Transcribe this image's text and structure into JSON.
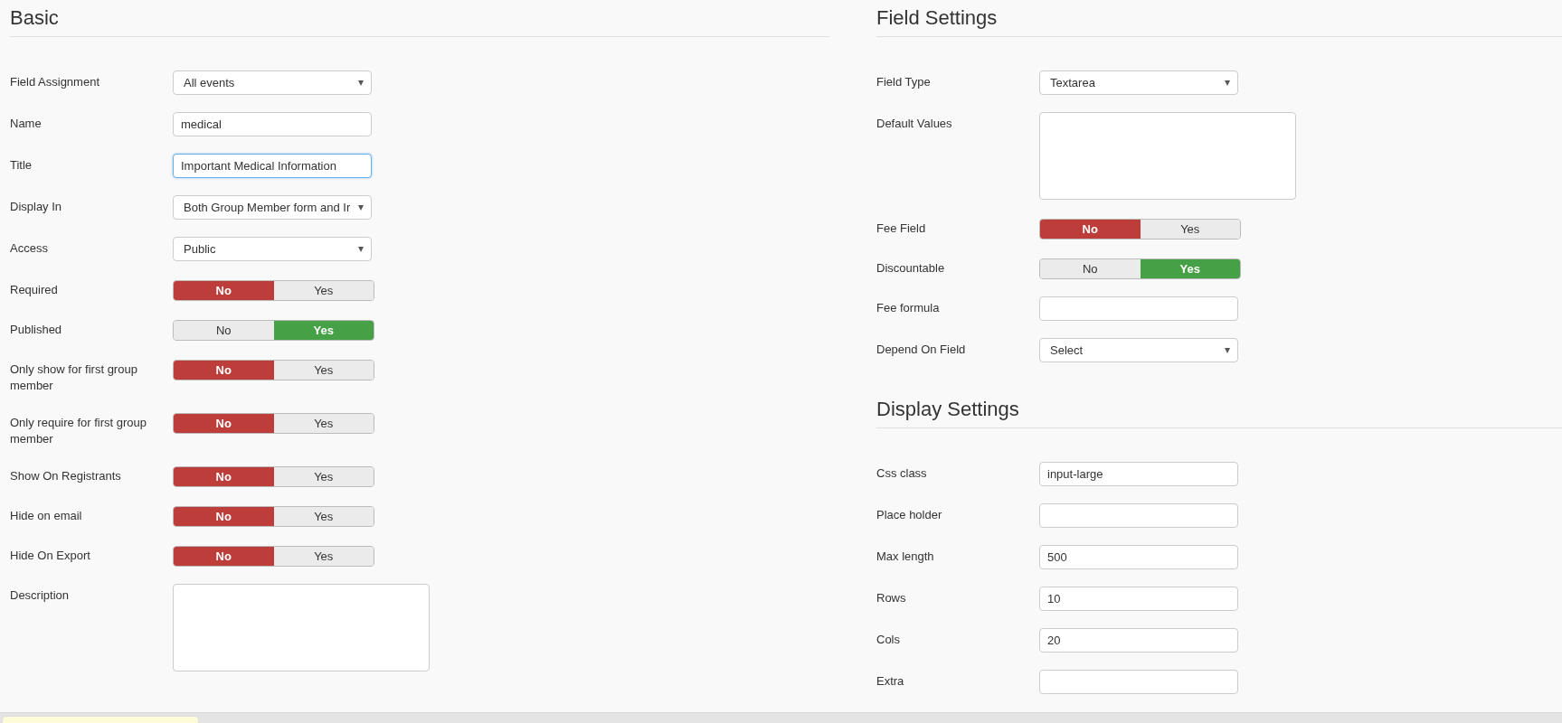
{
  "sections": [
    {
      "title": "Basic",
      "fields": [
        {
          "label": "Field Assignment",
          "kind": "select",
          "value": "All events"
        },
        {
          "label": "Name",
          "kind": "text",
          "value": "medical",
          "focused": false
        },
        {
          "label": "Title",
          "kind": "text",
          "value": "Important Medical Information",
          "focused": true
        },
        {
          "label": "Display In",
          "kind": "select",
          "value": "Both Group Member form and Ir"
        },
        {
          "label": "Access",
          "kind": "select",
          "value": "Public"
        },
        {
          "label": "Required",
          "kind": "toggle",
          "options": [
            {
              "label": "No",
              "selected": true
            },
            {
              "label": "Yes",
              "selected": false
            }
          ]
        },
        {
          "label": "Published",
          "kind": "toggle",
          "options": [
            {
              "label": "No",
              "selected": false
            },
            {
              "label": "Yes",
              "selected": true
            }
          ]
        },
        {
          "label": "Only show for first group member",
          "kind": "toggle",
          "options": [
            {
              "label": "No",
              "selected": true
            },
            {
              "label": "Yes",
              "selected": false
            }
          ]
        },
        {
          "label": "Only require for first group member",
          "kind": "toggle",
          "options": [
            {
              "label": "No",
              "selected": true
            },
            {
              "label": "Yes",
              "selected": false
            }
          ]
        },
        {
          "label": "Show On Registrants",
          "kind": "toggle",
          "options": [
            {
              "label": "No",
              "selected": true
            },
            {
              "label": "Yes",
              "selected": false
            }
          ]
        },
        {
          "label": "Hide on email",
          "kind": "toggle",
          "options": [
            {
              "label": "No",
              "selected": true
            },
            {
              "label": "Yes",
              "selected": false
            }
          ]
        },
        {
          "label": "Hide On Export",
          "kind": "toggle",
          "options": [
            {
              "label": "No",
              "selected": true
            },
            {
              "label": "Yes",
              "selected": false
            }
          ]
        },
        {
          "label": "Description",
          "kind": "textarea"
        }
      ]
    },
    {
      "title": "Field Settings",
      "fields": [
        {
          "label": "Field Type",
          "kind": "select",
          "value": "Textarea"
        },
        {
          "label": "Default Values",
          "kind": "textarea"
        },
        {
          "label": "Fee Field",
          "kind": "toggle",
          "options": [
            {
              "label": "No",
              "selected": true
            },
            {
              "label": "Yes",
              "selected": false
            }
          ]
        },
        {
          "label": "Discountable",
          "kind": "toggle",
          "options": [
            {
              "label": "No",
              "selected": false
            },
            {
              "label": "Yes",
              "selected": true
            }
          ]
        },
        {
          "label": "Fee formula",
          "kind": "text",
          "focused": false
        },
        {
          "label": "Depend On Field",
          "kind": "select",
          "value": "Select"
        }
      ]
    },
    {
      "title": "Display Settings",
      "fields": [
        {
          "label": "Css class",
          "kind": "text",
          "value": "input-large",
          "focused": false
        },
        {
          "label": "Place holder",
          "kind": "text",
          "focused": false
        },
        {
          "label": "Max length",
          "kind": "text",
          "value": "500",
          "focused": false
        },
        {
          "label": "Rows",
          "kind": "text",
          "value": "10",
          "focused": false
        },
        {
          "label": "Cols",
          "kind": "text",
          "value": "20",
          "focused": false
        },
        {
          "label": "Extra",
          "kind": "text",
          "focused": false
        }
      ]
    }
  ]
}
